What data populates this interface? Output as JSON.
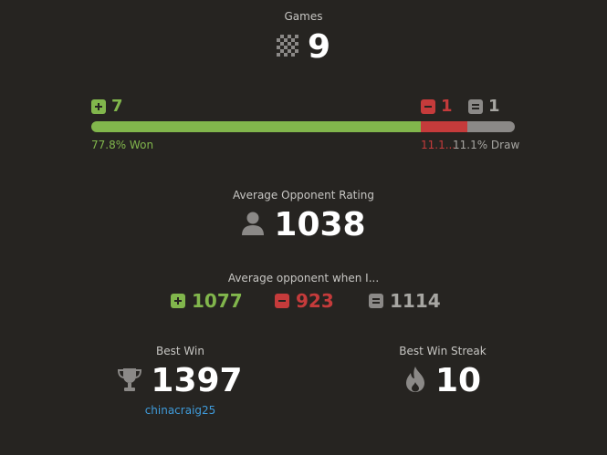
{
  "games": {
    "label": "Games",
    "count": "9",
    "icon": "chessboard-icon"
  },
  "results": {
    "wins": "7",
    "losses": "1",
    "draws": "1",
    "won_pct": "77.8% Won",
    "loss_pct": "11.1...",
    "draw_pct": "11.1% Draw",
    "win_fraction": 0.778,
    "loss_fraction": 0.111,
    "draw_fraction": 0.111,
    "colors": {
      "win": "#81b64c",
      "loss": "#c53b3b",
      "draw": "#8b8987"
    }
  },
  "average_rating": {
    "label": "Average Opponent Rating",
    "value": "1038",
    "icon": "person-icon"
  },
  "average_when": {
    "label": "Average opponent when I...",
    "win": "1077",
    "loss": "923",
    "draw": "1114"
  },
  "best_win": {
    "label": "Best Win",
    "value": "1397",
    "opponent": "chinacraig25",
    "icon": "trophy-icon",
    "link_color": "#3f9bda"
  },
  "best_win_streak": {
    "label": "Best Win Streak",
    "value": "10",
    "icon": "flame-icon"
  }
}
